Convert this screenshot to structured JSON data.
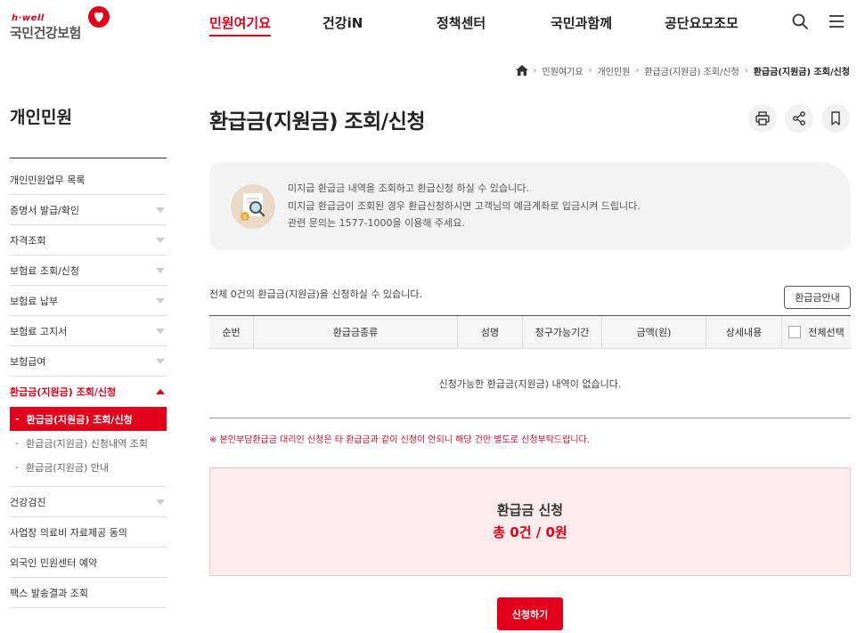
{
  "header": {
    "logo_tagline": "h·well",
    "logo_name": "국민건강보험",
    "nav": [
      "민원여기요",
      "건강iN",
      "정책센터",
      "국민과함께",
      "공단요모조모"
    ],
    "active_nav": "민원여기요",
    "search_icon": "search-icon",
    "menu_icon": "menu-icon"
  },
  "breadcrumb": [
    "민원여기요",
    "개인민원",
    "환급금(지원금) 조회/신청",
    "환급금(지원금) 조회/신청"
  ],
  "sidebar": {
    "title": "개인민원",
    "items": [
      {
        "label": "개인민원업무 목록",
        "arrow": false
      },
      {
        "label": "증명서 발급/확인",
        "arrow": true
      },
      {
        "label": "자격조회",
        "arrow": true
      },
      {
        "label": "보험료 조회/신청",
        "arrow": true
      },
      {
        "label": "보험료 납부",
        "arrow": true
      },
      {
        "label": "보험료 고지서",
        "arrow": true
      },
      {
        "label": "보험급여",
        "arrow": true
      },
      {
        "label": "환급금(지원금) 조회/신청",
        "arrow": true,
        "open": true
      }
    ],
    "sub_items": [
      "환급금(지원금) 조회/신청",
      "환급금(지원금) 신청내역 조회",
      "환급금(지원금) 안내"
    ],
    "items_after": [
      {
        "label": "건강검진",
        "arrow": true
      },
      {
        "label": "사업장 의료비 자료제공 동의",
        "arrow": false
      },
      {
        "label": "외국인 민원센터 예약",
        "arrow": false
      },
      {
        "label": "팩스 발송결과 조회",
        "arrow": false
      }
    ]
  },
  "main": {
    "title": "환급금(지원금) 조회/신청",
    "info_lines": [
      "미지급 환급금 내역을 조회하고 환급신청 하실 수 있습니다.",
      "미지급 환급금이 조회된 경우 환급신청하시면 고객님의 예금계좌로 입금시켜 드립니다.",
      "관련 문의는 1577-1000을 이용해 주세요."
    ],
    "count_text": "전체 0건의 환급금(지원금)을 신청하실 수 있습니다.",
    "guide_button": "환급금안내",
    "table_headers": [
      "순번",
      "환급금종류",
      "성명",
      "청구가능기간",
      "금액(원)",
      "상세내용",
      "전체선택"
    ],
    "empty_message": "신청가능한 환급금(지원금) 내역이 없습니다.",
    "notice": "※ 본인부담환급금 대리인 신청은 타 환급금과 같이 신청이 안되니 해당 건만 별도로 신청부탁드립니다.",
    "summary_title": "환급금 신청",
    "summary_value": "총 0건 / 0원",
    "apply_button": "신청하기"
  },
  "colors": {
    "brand": "#e2001a",
    "summary_bg": "#fdecec",
    "info_bg": "#f3f3f3"
  }
}
